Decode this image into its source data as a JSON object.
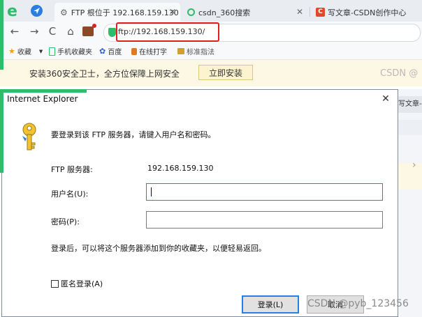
{
  "tabs": [
    {
      "label": "FTP 根位于 192.168.159.130",
      "active": true
    },
    {
      "label": "csdn_360搜索",
      "active": false
    },
    {
      "label": "写文章-CSDN创作中心",
      "active": false
    }
  ],
  "address": {
    "url": "ftp://192.168.159.130/"
  },
  "bookmarks": [
    {
      "label": "收藏"
    },
    {
      "label": "手机收藏夹"
    },
    {
      "label": "百度"
    },
    {
      "label": "在线打字"
    },
    {
      "label": "标准指法"
    }
  ],
  "infobar": {
    "message": "安装360安全卫士，全方位保障上网安全",
    "button": "立即安装",
    "right_text": "CSDN @"
  },
  "background_page": {
    "tab_fragment": "写文章-"
  },
  "dialog": {
    "title": "Internet Explorer",
    "prompt": "要登录到该 FTP 服务器，请键入用户名和密码。",
    "server_label": "FTP 服务器:",
    "server_value": "192.168.159.130",
    "username_label": "用户名(U):",
    "username_value": "",
    "password_label": "密码(P):",
    "password_value": "",
    "note": "登录后，可以将这个服务器添加到你的收藏夹，以便轻易返回。",
    "anonymous_label": "匿名登录(A)",
    "anonymous_checked": false,
    "login_button": "登录(L)",
    "cancel_button": "取消"
  },
  "watermark": "CSDN @pyb_123456",
  "colors": {
    "green_highlight": "#2ebd6b",
    "red_box": "#e02020",
    "infobar_bg": "#fdf8e4"
  }
}
